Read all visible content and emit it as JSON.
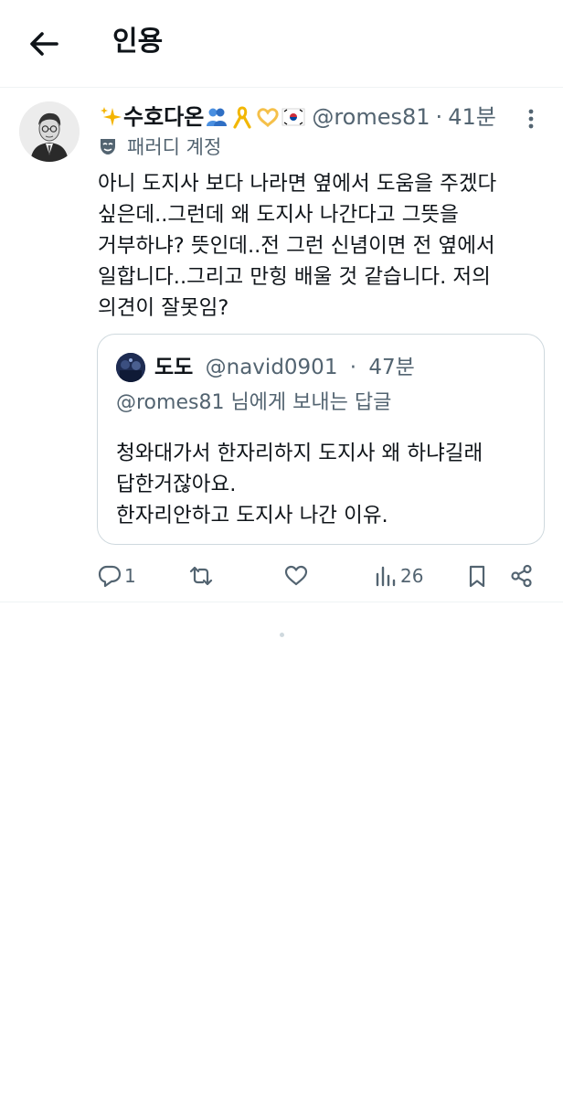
{
  "header": {
    "title": "인용"
  },
  "tweet": {
    "display_name": "수호다온",
    "emojis": [
      "sparkles-emoji",
      "people-emoji",
      "yellow-ribbon-emoji",
      "heart-hands-emoji",
      "korea-flag-emoji"
    ],
    "handle": "@romes81",
    "separator": "·",
    "time": "41분",
    "account_label": "패러디 계정",
    "text": "아니 도지사 보다 나라면 옆에서 도움을 주겠다\n싶은데..그런데 왜 도지사 나간다고 그뜻을\n거부하냐? 뜻인데..전 그런 신념이면 전 옆에서\n일합니다..그리고 만힝 배울 것 같습니다. 저의\n의견이 잘못임?",
    "quote": {
      "display_name": "도도",
      "handle": "@navid0901",
      "separator": "·",
      "time": "47분",
      "reply_mention": "@romes81",
      "reply_suffix": " 님에게 보내는 답글",
      "text": "청와대가서 한자리하지 도지사 왜 하냐길래\n답한거잖아요.\n한자리안하고 도지사 나간 이유."
    },
    "actions": {
      "reply_count": "1",
      "retweet_count": "",
      "like_count": "",
      "views_count": "26"
    }
  },
  "colors": {
    "text": "#0f1419",
    "secondary": "#536471",
    "border": "#cfd9de",
    "divider": "#eff3f4"
  }
}
